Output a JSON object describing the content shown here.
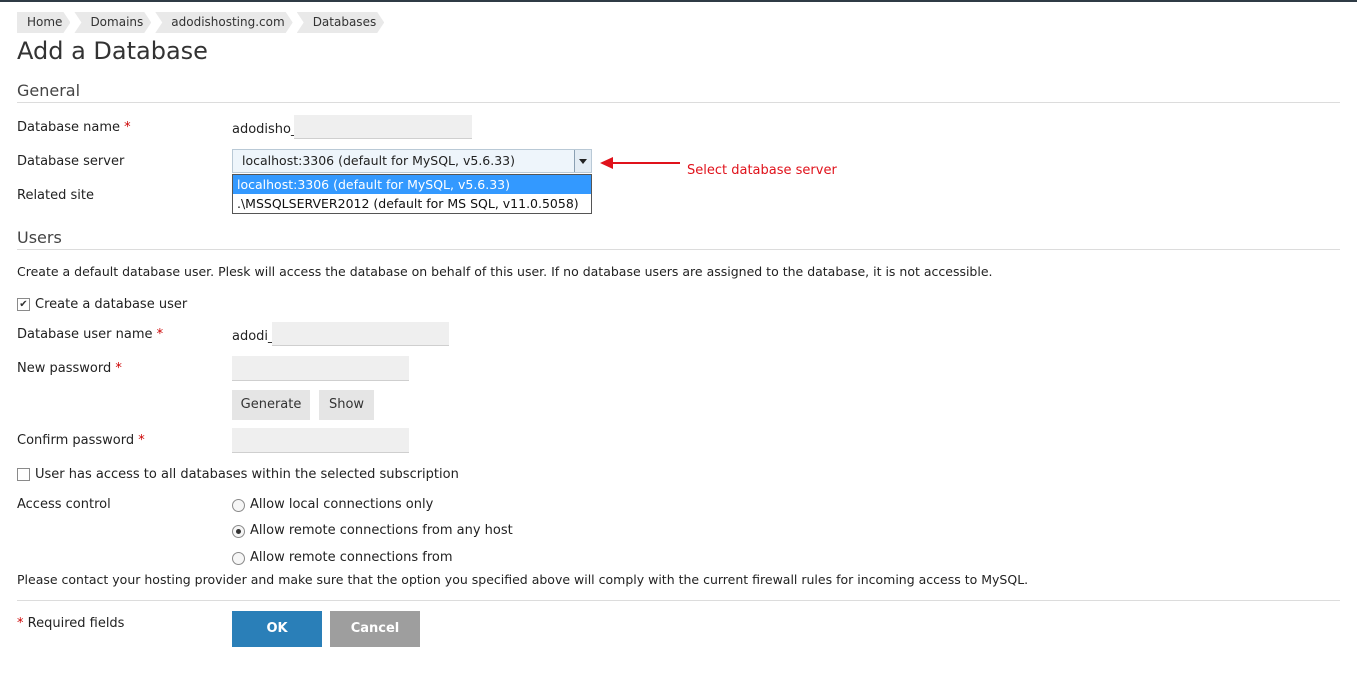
{
  "breadcrumb": [
    "Home",
    "Domains",
    "adodishosting.com",
    "Databases"
  ],
  "page_title": "Add a Database",
  "general": {
    "title": "General",
    "db_name_label": "Database name",
    "db_name_prefix": "adodisho_",
    "db_server_label": "Database server",
    "db_server_value": "localhost:3306 (default for MySQL, v5.6.33)",
    "db_server_options": [
      "localhost:3306 (default for MySQL, v5.6.33)",
      ".\\MSSQLSERVER2012 (default for MS SQL, v11.0.5058)"
    ],
    "related_site_label": "Related site",
    "annotation": "Select database server"
  },
  "users": {
    "title": "Users",
    "description": "Create a default database user. Plesk will access the database on behalf of this user. If no database users are assigned to the database, it is not accessible.",
    "create_user_label": "Create a database user",
    "create_user_checked": true,
    "user_name_label": "Database user name",
    "user_name_prefix": "adodi_",
    "new_password_label": "New password",
    "generate_label": "Generate",
    "show_label": "Show",
    "confirm_password_label": "Confirm password",
    "all_db_access_label": "User has access to all databases within the selected subscription",
    "all_db_access_checked": false,
    "access_control_label": "Access control",
    "access_options": [
      "Allow local connections only",
      "Allow remote connections from any host",
      "Allow remote connections from"
    ],
    "access_selected": 1,
    "firewall_note": "Please contact your hosting provider and make sure that the option you specified above will comply with the current firewall rules for incoming access to MySQL."
  },
  "footer": {
    "required_note": "Required fields",
    "ok_label": "OK",
    "cancel_label": "Cancel"
  },
  "colors": {
    "required_star": "#cc0000",
    "ok_button": "#2a7fb8",
    "cancel_button": "#9e9e9e",
    "dropdown_highlight": "#3399ff",
    "annotation": "#e0121b"
  }
}
